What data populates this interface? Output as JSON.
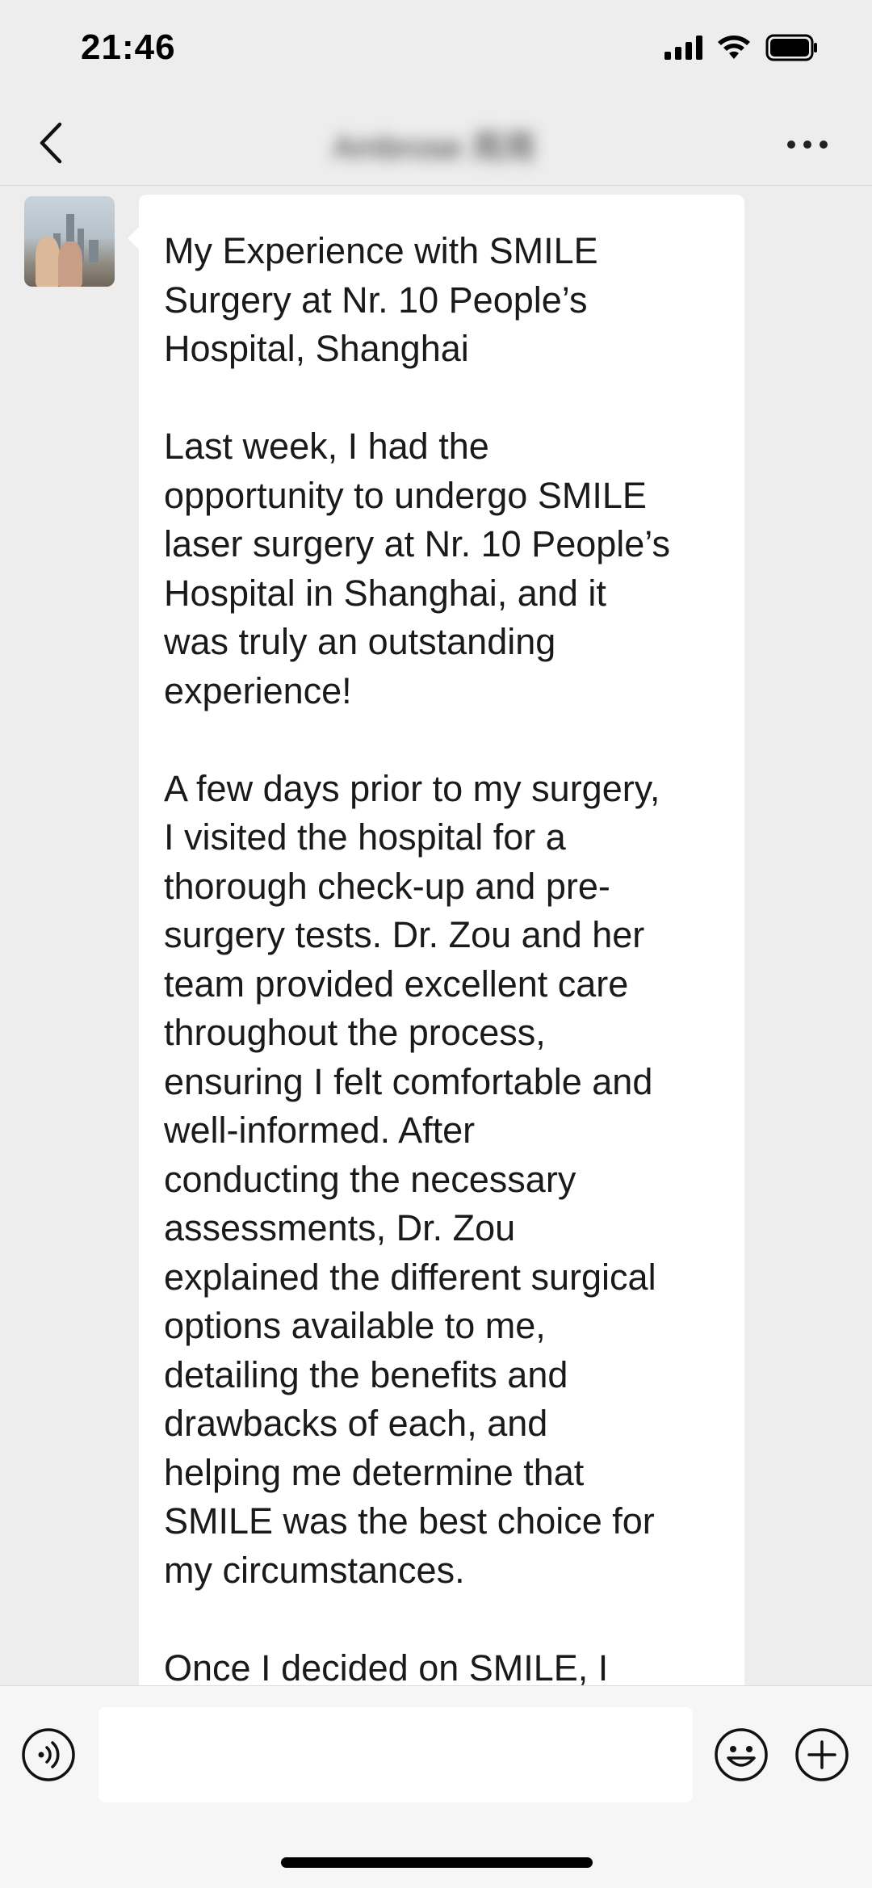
{
  "status_bar": {
    "time": "21:46"
  },
  "nav": {
    "title": "Ambrose 周周",
    "back_icon": "chevron-left-icon",
    "more_icon": "more-dots-icon"
  },
  "message": {
    "paragraphs": [
      "My Experience with SMILE\nSurgery at Nr. 10 People’s\nHospital, Shanghai",
      "Last week, I had the\nopportunity to undergo SMILE\nlaser surgery at Nr. 10 People’s\nHospital in Shanghai, and it\nwas truly an outstanding\nexperience!",
      "A few days prior to my surgery,\nI visited the hospital for a\nthorough check-up and pre-\nsurgery tests. Dr. Zou and her\nteam provided excellent care\nthroughout the process,\nensuring I felt comfortable and\nwell-informed. After\nconducting the necessary\nassessments, Dr. Zou\nexplained the different surgical\noptions available to me,\ndetailing the benefits and\ndrawbacks of each, and\nhelping me determine that\nSMILE was the best choice for\nmy circumstances.",
      "Once I decided on SMILE, I"
    ]
  },
  "input_bar": {
    "placeholder": "",
    "voice_icon": "voice-icon",
    "emoji_icon": "emoji-icon",
    "plus_icon": "plus-icon"
  }
}
